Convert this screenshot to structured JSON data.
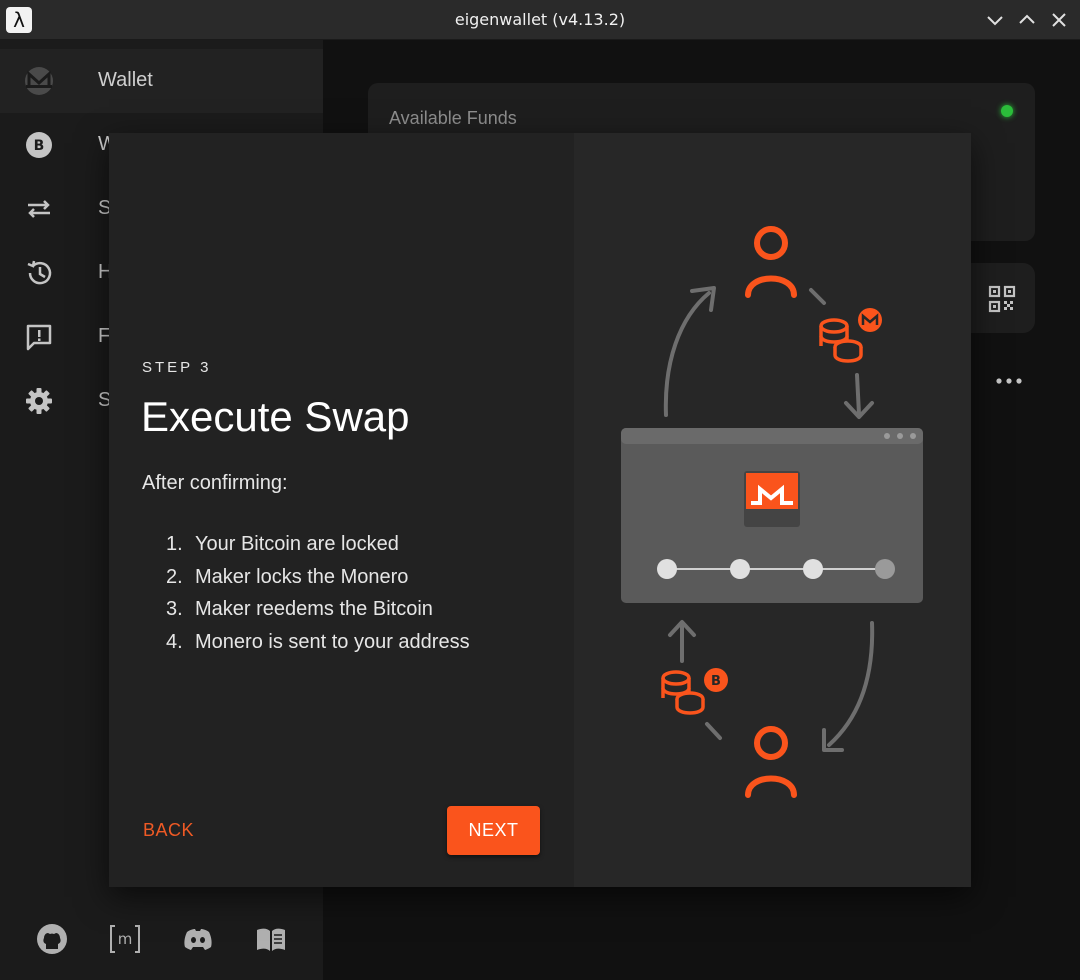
{
  "window": {
    "title": "eigenwallet (v4.13.2)",
    "app_icon": "λ",
    "controls": [
      "minimize-icon",
      "maximize-icon",
      "close-icon"
    ]
  },
  "sidebar": {
    "items": [
      {
        "label": "Wallet",
        "icon": "monero-icon",
        "active": true
      },
      {
        "label": "W",
        "icon": "bitcoin-icon"
      },
      {
        "label": "S",
        "icon": "swap-arrows-icon"
      },
      {
        "label": "H",
        "icon": "history-icon"
      },
      {
        "label": "F",
        "icon": "feedback-icon"
      },
      {
        "label": "S",
        "icon": "gear-icon"
      }
    ],
    "footer_icons": [
      "github-icon",
      "matrix-icon",
      "discord-icon",
      "book-icon"
    ]
  },
  "main": {
    "funds_label": "Available Funds",
    "status_color": "#2bbd3a"
  },
  "dialog": {
    "step_label": "STEP 3",
    "title": "Execute Swap",
    "intro": "After confirming:",
    "steps": [
      {
        "num": "1.",
        "text": "Your Bitcoin are locked"
      },
      {
        "num": "2.",
        "text": "Maker locks the Monero"
      },
      {
        "num": "3.",
        "text": "Maker reedems the Bitcoin"
      },
      {
        "num": "4.",
        "text": "Monero is sent to your address"
      }
    ],
    "back_label": "BACK",
    "next_label": "NEXT",
    "accent": "#fa541c"
  }
}
